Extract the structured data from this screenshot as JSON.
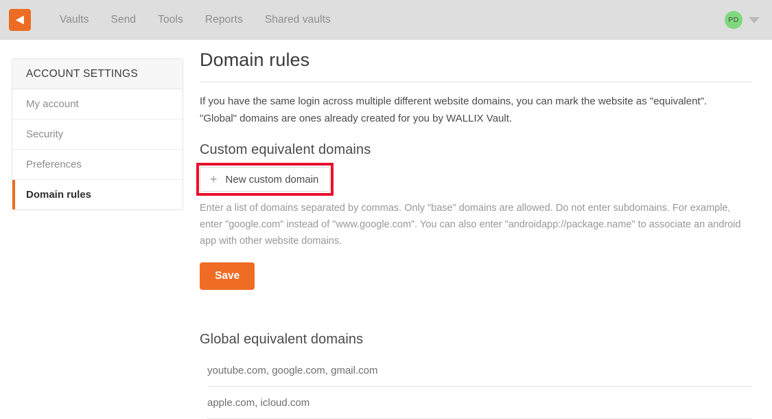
{
  "brand": {
    "logo_icon": "wallix-vault-logo-icon",
    "accent_color": "#ed6c23",
    "annotation_color": "#e8112d"
  },
  "header": {
    "nav_items": [
      {
        "label": "Vaults"
      },
      {
        "label": "Send"
      },
      {
        "label": "Tools"
      },
      {
        "label": "Reports"
      },
      {
        "label": "Shared vaults"
      }
    ],
    "account": {
      "avatar_initials": "PD",
      "avatar_color": "#7ed97e",
      "caret_icon": "chevron-down-icon"
    }
  },
  "sidebar": {
    "title": "ACCOUNT SETTINGS",
    "items": [
      {
        "label": "My account",
        "active": false
      },
      {
        "label": "Security",
        "active": false
      },
      {
        "label": "Preferences",
        "active": false
      },
      {
        "label": "Domain rules",
        "active": true
      }
    ]
  },
  "main": {
    "page_title": "Domain rules",
    "intro_line1": "If you have the same login across multiple different website domains, you can mark the website as \"equivalent\".",
    "intro_line2": "\"Global\" domains are ones already created for you by WALLIX Vault.",
    "custom_section": {
      "title": "Custom equivalent domains",
      "new_domain_button": "New custom domain",
      "plus_icon": "plus-icon",
      "help_text": "Enter a list of domains separated by commas. Only \"base\" domains are allowed. Do not enter subdomains. For example, enter \"google.com\" instead of \"www.google.com\". You can also enter \"androidapp://package.name\" to associate an android app with other website domains.",
      "save_button": "Save"
    },
    "global_section": {
      "title": "Global equivalent domains",
      "rows": [
        {
          "domains": "youtube.com, google.com, gmail.com"
        },
        {
          "domains": "apple.com, icloud.com"
        }
      ]
    }
  }
}
